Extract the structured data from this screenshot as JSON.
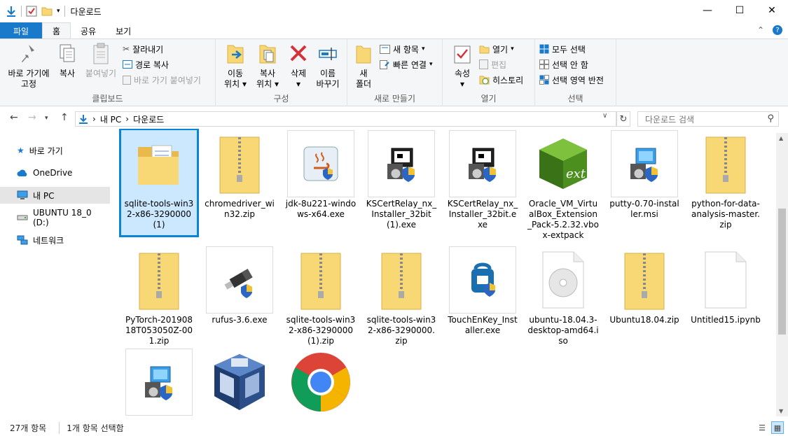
{
  "window": {
    "title": "다운로드"
  },
  "tabs": [
    {
      "label": "파일"
    },
    {
      "label": "홈"
    },
    {
      "label": "공유"
    },
    {
      "label": "보기"
    }
  ],
  "ribbon": {
    "clipboard": {
      "pin_label_1": "바로 가기에",
      "pin_label_2": "고정",
      "copy": "복사",
      "paste": "붙여넣기",
      "cut": "잘라내기",
      "copy_path": "경로 복사",
      "paste_shortcut": "바로 가기 붙여넣기",
      "group": "클립보드"
    },
    "organize": {
      "move_1": "이동",
      "move_2": "위치",
      "copy_1": "복사",
      "copy_2": "위치",
      "delete": "삭제",
      "rename_1": "이름",
      "rename_2": "바꾸기",
      "group": "구성"
    },
    "new": {
      "new_folder_1": "새",
      "new_folder_2": "폴더",
      "new_item": "새 항목",
      "easy_access": "빠른 연결",
      "group": "새로 만들기"
    },
    "open": {
      "properties": "속성",
      "open": "열기",
      "edit": "편집",
      "history": "히스토리",
      "group": "열기"
    },
    "select": {
      "select_all": "모두 선택",
      "select_none": "선택 안 함",
      "invert": "선택 영역 반전",
      "group": "선택"
    }
  },
  "address": {
    "crumb1": "내 PC",
    "sep": "›",
    "crumb2": "다운로드",
    "search_placeholder": "다운로드 검색"
  },
  "nav": [
    {
      "label": "바로 가기",
      "icon": "star-icon"
    },
    {
      "label": "OneDrive",
      "icon": "cloud-icon"
    },
    {
      "label": "내 PC",
      "icon": "pc-icon"
    },
    {
      "label": "UBUNTU 18_0 (D:)",
      "icon": "drive-icon"
    },
    {
      "label": "네트워크",
      "icon": "network-icon"
    }
  ],
  "files": [
    {
      "name": "sqlite-tools-win32-x86-3290000 (1)",
      "type": "folder"
    },
    {
      "name": "chromedriver_win32.zip",
      "type": "zip"
    },
    {
      "name": "jdk-8u221-windows-x64.exe",
      "type": "java"
    },
    {
      "name": "KSCertRelay_nx_Installer_32bit (1).exe",
      "type": "installer"
    },
    {
      "name": "KSCertRelay_nx_Installer_32bit.exe",
      "type": "installer"
    },
    {
      "name": "Oracle_VM_VirtualBox_Extension_Pack-5.2.32.vbox-extpack",
      "type": "ext"
    },
    {
      "name": "putty-0.70-installer.msi",
      "type": "msi"
    },
    {
      "name": "python-for-data-analysis-master.zip",
      "type": "zip"
    },
    {
      "name": "PyTorch-20190818T053050Z-001.zip",
      "type": "zip"
    },
    {
      "name": "rufus-3.6.exe",
      "type": "usb"
    },
    {
      "name": "sqlite-tools-win32-x86-3290000 (1).zip",
      "type": "zip"
    },
    {
      "name": "sqlite-tools-win32-x86-3290000.zip",
      "type": "zip"
    },
    {
      "name": "TouchEnKey_Installer.exe",
      "type": "touch"
    },
    {
      "name": "ubuntu-18.04.3-desktop-amd64.iso",
      "type": "iso"
    },
    {
      "name": "Ubuntu18.04.zip",
      "type": "zip"
    },
    {
      "name": "Untitled15.ipynb",
      "type": "doc"
    },
    {
      "name": "",
      "type": "msi"
    },
    {
      "name": "",
      "type": "vbox"
    },
    {
      "name": "",
      "type": "chrome"
    }
  ],
  "status": {
    "count": "27개 항목",
    "selected": "1개 항목 선택함"
  },
  "colors": {
    "accent": "#1979ca",
    "selection": "#cce8ff",
    "selection_border": "#0a84d6",
    "folder": "#f8d775"
  }
}
